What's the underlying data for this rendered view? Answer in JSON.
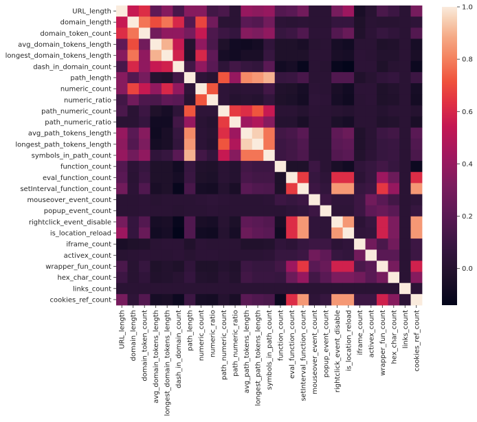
{
  "chart_data": {
    "type": "heatmap",
    "title": "",
    "xlabel": "",
    "ylabel": "",
    "colormap": "rocket",
    "colorbar": {
      "vmin": -0.14,
      "vmax": 1.0,
      "ticks": [
        1.0,
        0.8,
        0.6,
        0.4,
        0.2,
        0.0
      ],
      "tick_labels": [
        "1.0",
        "0.8",
        "0.6",
        "0.4",
        "0.2",
        "0.0"
      ],
      "placement": "right"
    },
    "labels": [
      "URL_length",
      "domain_length",
      "domain_token_count",
      "avg_domain_tokens_length",
      "longest_domain_tokens_length",
      "dash_in_domain_count",
      "path_length",
      "numeric_count",
      "numeric_ratio",
      "path_numeric_count",
      "path_numeric_ratio",
      "avg_path_tokens_length",
      "longest_path_tokens_length",
      "symbols_in_path_count",
      "function_count",
      "eval_function_count",
      "setInterval_function_count",
      "mouseover_event_count",
      "popup_event_count",
      "rightclick_event_disable",
      "is_location_reload",
      "iframe_count",
      "activex_count",
      "wrapper_fun_count",
      "hex_char_count",
      "links_count",
      "cookies_ref_count"
    ],
    "matrix": [
      [
        1.0,
        0.55,
        0.62,
        0.22,
        0.35,
        0.14,
        0.35,
        0.35,
        0.12,
        0.15,
        0.02,
        0.4,
        0.37,
        0.4,
        0.18,
        0.2,
        0.28,
        0.02,
        0.02,
        0.3,
        0.42,
        -0.05,
        0.01,
        0.15,
        0.1,
        0.02,
        0.3
      ],
      [
        0.55,
        1.0,
        0.78,
        0.7,
        0.78,
        0.6,
        0.18,
        0.68,
        0.28,
        0.02,
        0.02,
        0.2,
        0.18,
        0.28,
        0.03,
        0.02,
        0.03,
        0.02,
        0.02,
        0.07,
        0.07,
        -0.03,
        0.02,
        0.01,
        0.01,
        0.02,
        0.04
      ],
      [
        0.62,
        0.78,
        1.0,
        0.28,
        0.38,
        0.38,
        0.3,
        0.55,
        0.16,
        0.1,
        0.07,
        0.35,
        0.32,
        0.38,
        0.08,
        0.1,
        0.17,
        0.03,
        0.03,
        0.18,
        0.25,
        -0.02,
        0.03,
        0.08,
        0.05,
        0.02,
        0.18
      ],
      [
        0.22,
        0.7,
        0.28,
        1.0,
        0.9,
        0.55,
        0.0,
        0.38,
        0.15,
        -0.03,
        -0.08,
        -0.09,
        -0.07,
        0.05,
        -0.03,
        -0.03,
        -0.05,
        0.01,
        0.02,
        -0.06,
        -0.08,
        0.02,
        0.02,
        -0.03,
        -0.02,
        0.02,
        -0.06
      ],
      [
        0.35,
        0.78,
        0.38,
        0.9,
        1.0,
        0.58,
        -0.02,
        0.6,
        0.22,
        -0.06,
        -0.08,
        -0.05,
        -0.05,
        0.08,
        -0.03,
        -0.03,
        -0.03,
        0.02,
        0.02,
        -0.05,
        -0.06,
        0.03,
        0.02,
        -0.01,
        -0.01,
        0.02,
        -0.05
      ],
      [
        0.14,
        0.6,
        0.38,
        0.55,
        0.58,
        1.0,
        0.12,
        0.38,
        0.2,
        0.04,
        0.12,
        0.08,
        0.06,
        0.2,
        -0.08,
        -0.06,
        -0.12,
        0.02,
        0.01,
        -0.12,
        -0.14,
        0.03,
        0.03,
        -0.03,
        0.01,
        0.02,
        -0.1
      ],
      [
        0.35,
        0.18,
        0.3,
        0.0,
        -0.02,
        0.12,
        1.0,
        0.04,
        0.01,
        0.72,
        0.4,
        0.82,
        0.85,
        0.9,
        0.08,
        0.09,
        0.14,
        0.02,
        0.02,
        0.17,
        0.17,
        -0.02,
        0.01,
        0.05,
        0.07,
        0.02,
        0.1
      ],
      [
        0.35,
        0.68,
        0.55,
        0.38,
        0.6,
        0.38,
        0.04,
        1.0,
        0.72,
        0.04,
        0.02,
        0.03,
        0.03,
        0.12,
        -0.02,
        -0.03,
        -0.06,
        0.03,
        0.02,
        -0.05,
        -0.08,
        0.03,
        0.03,
        -0.03,
        -0.01,
        0.02,
        -0.06
      ],
      [
        0.12,
        0.28,
        0.16,
        0.15,
        0.22,
        0.2,
        0.01,
        0.72,
        1.0,
        0.04,
        0.0,
        0.01,
        0.0,
        0.06,
        -0.03,
        -0.04,
        -0.07,
        0.04,
        0.03,
        -0.06,
        -0.09,
        0.02,
        0.03,
        -0.03,
        -0.02,
        0.02,
        -0.07
      ],
      [
        0.15,
        0.02,
        0.1,
        -0.03,
        -0.06,
        0.04,
        0.72,
        0.04,
        0.04,
        1.0,
        0.66,
        0.62,
        0.72,
        0.55,
        0.02,
        0.02,
        0.0,
        0.03,
        0.02,
        0.01,
        0.0,
        0.02,
        0.02,
        0.0,
        0.02,
        0.02,
        0.0
      ],
      [
        0.02,
        0.02,
        0.07,
        -0.08,
        -0.08,
        0.12,
        0.4,
        0.02,
        0.0,
        0.66,
        1.0,
        0.42,
        0.48,
        0.35,
        0.0,
        0.0,
        -0.05,
        0.02,
        0.02,
        -0.04,
        -0.06,
        0.02,
        0.02,
        -0.02,
        -0.01,
        0.02,
        -0.05
      ],
      [
        0.4,
        0.2,
        0.35,
        -0.09,
        -0.05,
        0.08,
        0.82,
        0.03,
        0.01,
        0.62,
        0.42,
        1.0,
        0.95,
        0.78,
        0.12,
        0.14,
        0.2,
        0.02,
        0.02,
        0.22,
        0.26,
        -0.02,
        0.02,
        0.1,
        0.12,
        0.02,
        0.2
      ],
      [
        0.37,
        0.18,
        0.32,
        -0.07,
        -0.05,
        0.06,
        0.85,
        0.03,
        0.0,
        0.72,
        0.48,
        0.95,
        1.0,
        0.78,
        0.1,
        0.12,
        0.17,
        0.02,
        0.02,
        0.2,
        0.22,
        -0.02,
        0.02,
        0.08,
        0.09,
        0.02,
        0.17
      ],
      [
        0.4,
        0.28,
        0.38,
        0.05,
        0.08,
        0.2,
        0.9,
        0.12,
        0.06,
        0.55,
        0.35,
        0.78,
        0.78,
        1.0,
        0.1,
        0.12,
        0.16,
        0.03,
        0.02,
        0.18,
        0.2,
        -0.01,
        0.03,
        0.08,
        0.09,
        0.02,
        0.15
      ],
      [
        0.18,
        0.03,
        0.08,
        -0.03,
        -0.03,
        -0.08,
        0.08,
        -0.02,
        -0.03,
        0.02,
        0.0,
        0.12,
        0.1,
        0.1,
        1.0,
        -0.03,
        -0.03,
        0.1,
        0.02,
        -0.05,
        -0.08,
        0.05,
        0.08,
        0.12,
        0.08,
        0.02,
        -0.1
      ],
      [
        0.2,
        0.02,
        0.1,
        -0.03,
        -0.03,
        -0.06,
        0.09,
        -0.03,
        -0.04,
        0.02,
        0.0,
        0.14,
        0.12,
        0.12,
        -0.03,
        1.0,
        0.66,
        0.08,
        0.04,
        0.62,
        0.62,
        0.03,
        0.08,
        0.42,
        0.26,
        0.02,
        0.62
      ],
      [
        0.28,
        0.03,
        0.17,
        -0.05,
        -0.03,
        -0.12,
        0.14,
        -0.06,
        -0.07,
        0.0,
        -0.05,
        0.2,
        0.17,
        0.16,
        -0.03,
        0.66,
        1.0,
        0.1,
        0.06,
        0.85,
        0.85,
        0.08,
        0.1,
        0.65,
        0.4,
        0.02,
        0.85
      ],
      [
        0.02,
        0.02,
        0.03,
        0.01,
        0.02,
        0.02,
        0.02,
        0.03,
        0.04,
        0.03,
        0.02,
        0.02,
        0.02,
        0.03,
        0.1,
        0.08,
        0.1,
        1.0,
        0.1,
        0.05,
        0.05,
        0.1,
        0.28,
        0.2,
        0.12,
        0.02,
        0.04
      ],
      [
        0.02,
        0.02,
        0.03,
        0.02,
        0.02,
        0.01,
        0.02,
        0.02,
        0.03,
        0.02,
        0.02,
        0.02,
        0.02,
        0.02,
        0.02,
        0.04,
        0.06,
        0.1,
        1.0,
        0.04,
        0.04,
        0.1,
        0.22,
        0.25,
        0.2,
        0.02,
        0.08
      ],
      [
        0.3,
        0.07,
        0.18,
        -0.06,
        -0.05,
        -0.12,
        0.17,
        -0.05,
        -0.06,
        0.01,
        -0.04,
        0.22,
        0.2,
        0.18,
        -0.05,
        0.62,
        0.85,
        0.05,
        0.04,
        1.0,
        0.85,
        0.03,
        0.08,
        0.58,
        0.32,
        0.02,
        0.85
      ],
      [
        0.42,
        0.07,
        0.25,
        -0.08,
        -0.06,
        -0.14,
        0.17,
        -0.08,
        -0.09,
        0.0,
        -0.06,
        0.26,
        0.22,
        0.2,
        -0.08,
        0.62,
        0.85,
        0.05,
        0.04,
        0.85,
        1.0,
        0.05,
        0.06,
        0.58,
        0.32,
        0.02,
        0.85
      ],
      [
        -0.05,
        -0.03,
        -0.02,
        0.02,
        0.03,
        0.03,
        -0.02,
        0.03,
        0.02,
        0.02,
        0.02,
        -0.02,
        -0.02,
        -0.01,
        0.05,
        0.03,
        0.08,
        0.1,
        0.1,
        0.03,
        0.05,
        1.0,
        0.28,
        0.15,
        0.28,
        0.02,
        0.1
      ],
      [
        0.01,
        0.02,
        0.03,
        0.02,
        0.02,
        0.03,
        0.01,
        0.03,
        0.03,
        0.02,
        0.02,
        0.02,
        0.02,
        0.03,
        0.08,
        0.08,
        0.1,
        0.28,
        0.22,
        0.08,
        0.06,
        0.28,
        1.0,
        0.2,
        0.2,
        0.02,
        0.1
      ],
      [
        0.15,
        0.01,
        0.08,
        -0.03,
        -0.01,
        -0.03,
        0.05,
        -0.03,
        -0.03,
        0.0,
        -0.02,
        0.1,
        0.08,
        0.08,
        0.12,
        0.42,
        0.65,
        0.2,
        0.25,
        0.58,
        0.58,
        0.15,
        0.2,
        1.0,
        0.3,
        0.02,
        0.58
      ],
      [
        0.1,
        0.01,
        0.05,
        -0.02,
        -0.01,
        0.01,
        0.07,
        -0.01,
        -0.02,
        0.02,
        -0.01,
        0.12,
        0.09,
        0.09,
        0.08,
        0.26,
        0.4,
        0.12,
        0.2,
        0.32,
        0.32,
        0.28,
        0.2,
        0.3,
        1.0,
        0.02,
        0.35
      ],
      [
        0.02,
        0.02,
        0.02,
        0.02,
        0.02,
        0.02,
        0.02,
        0.02,
        0.02,
        0.02,
        0.02,
        0.02,
        0.02,
        0.02,
        0.02,
        0.02,
        0.02,
        0.02,
        0.02,
        0.02,
        0.02,
        0.02,
        0.02,
        0.02,
        0.02,
        1.0,
        0.03
      ],
      [
        0.3,
        0.04,
        0.18,
        -0.06,
        -0.05,
        -0.1,
        0.1,
        -0.06,
        -0.07,
        0.0,
        -0.05,
        0.2,
        0.17,
        0.15,
        -0.1,
        0.62,
        0.85,
        0.04,
        0.08,
        0.85,
        0.85,
        0.1,
        0.1,
        0.58,
        0.35,
        0.03,
        1.0
      ]
    ]
  }
}
